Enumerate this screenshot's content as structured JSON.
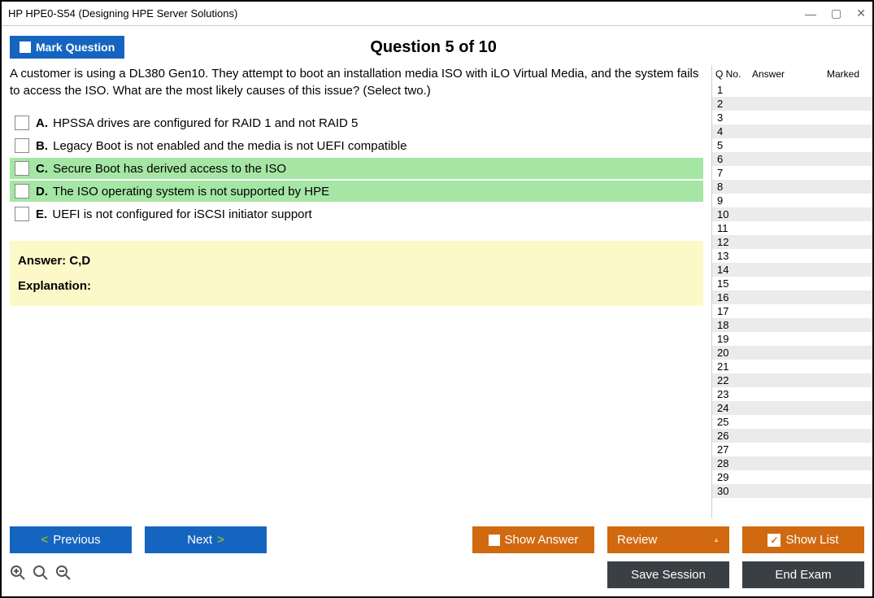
{
  "window": {
    "title": "HP HPE0-S54 (Designing HPE Server Solutions)"
  },
  "header": {
    "mark_label": "Mark Question",
    "question_title": "Question 5 of 10"
  },
  "question": {
    "text": "A customer is using a DL380 Gen10. They attempt to boot an installation media ISO with iLO Virtual Media, and the system fails to access the ISO. What are the most likely causes of this issue? (Select two.)",
    "options": [
      {
        "letter": "A.",
        "text": "HPSSA drives are configured for RAID 1 and not RAID 5",
        "correct": false
      },
      {
        "letter": "B.",
        "text": "Legacy Boot is not enabled and the media is not UEFI compatible",
        "correct": false
      },
      {
        "letter": "C.",
        "text": "Secure Boot has derived access to the ISO",
        "correct": true
      },
      {
        "letter": "D.",
        "text": "The ISO operating system is not supported by HPE",
        "correct": true
      },
      {
        "letter": "E.",
        "text": "UEFI is not configured for iSCSI initiator support",
        "correct": false
      }
    ]
  },
  "answer": {
    "line": "Answer: C,D",
    "explanation_label": "Explanation:"
  },
  "sidebar": {
    "col_qno": "Q No.",
    "col_answer": "Answer",
    "col_marked": "Marked",
    "rows": [
      1,
      2,
      3,
      4,
      5,
      6,
      7,
      8,
      9,
      10,
      11,
      12,
      13,
      14,
      15,
      16,
      17,
      18,
      19,
      20,
      21,
      22,
      23,
      24,
      25,
      26,
      27,
      28,
      29,
      30
    ]
  },
  "buttons": {
    "previous": "Previous",
    "next": "Next",
    "show_answer": "Show Answer",
    "review": "Review",
    "show_list": "Show List",
    "save_session": "Save Session",
    "end_exam": "End Exam"
  }
}
